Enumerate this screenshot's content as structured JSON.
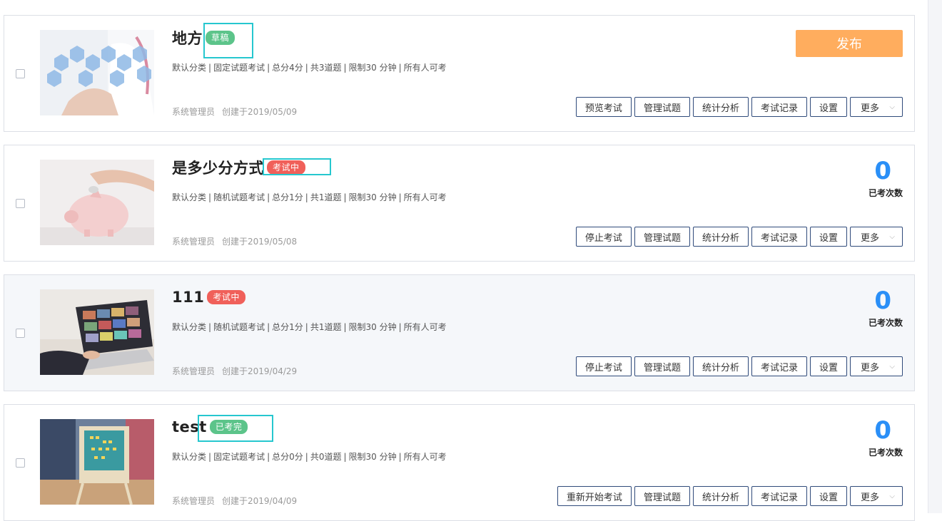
{
  "exams": [
    {
      "title": "地方",
      "badge": "草稿",
      "meta": [
        "默认分类",
        "固定试题考试",
        "总分4分",
        "共3道题",
        "限制30 分钟",
        "所有人可考"
      ],
      "creator": "系统管理员",
      "created": "创建于2019/05/09",
      "publish_label": "发布",
      "buttons": [
        "预览考试",
        "管理试题",
        "统计分析",
        "考试记录",
        "设置",
        "更多"
      ]
    },
    {
      "title": "是多少分方式",
      "badge": "考试中",
      "meta": [
        "默认分类",
        "随机试题考试",
        "总分1分",
        "共1道题",
        "限制30 分钟",
        "所有人可考"
      ],
      "creator": "系统管理员",
      "created": "创建于2019/05/08",
      "count": "0",
      "count_label": "已考次数",
      "buttons": [
        "停止考试",
        "管理试题",
        "统计分析",
        "考试记录",
        "设置",
        "更多"
      ]
    },
    {
      "title": "111",
      "badge": "考试中",
      "meta": [
        "默认分类",
        "随机试题考试",
        "总分1分",
        "共1道题",
        "限制30 分钟",
        "所有人可考"
      ],
      "creator": "系统管理员",
      "created": "创建于2019/04/29",
      "count": "0",
      "count_label": "已考次数",
      "buttons": [
        "停止考试",
        "管理试题",
        "统计分析",
        "考试记录",
        "设置",
        "更多"
      ]
    },
    {
      "title": "test",
      "badge": "已考完",
      "meta": [
        "默认分类",
        "固定试题考试",
        "总分0分",
        "共0道题",
        "限制30 分钟",
        "所有人可考"
      ],
      "creator": "系统管理员",
      "created": "创建于2019/04/09",
      "count": "0",
      "count_label": "已考次数",
      "buttons": [
        "重新开始考试",
        "管理试题",
        "统计分析",
        "考试记录",
        "设置",
        "更多"
      ]
    }
  ],
  "colors": {
    "publish": "#ffad5e",
    "count": "#2a8ff7",
    "badge_draft": "#5cc48a",
    "badge_running": "#f0605a",
    "badge_done": "#5cc48a",
    "highlight": "#26c7cf"
  }
}
